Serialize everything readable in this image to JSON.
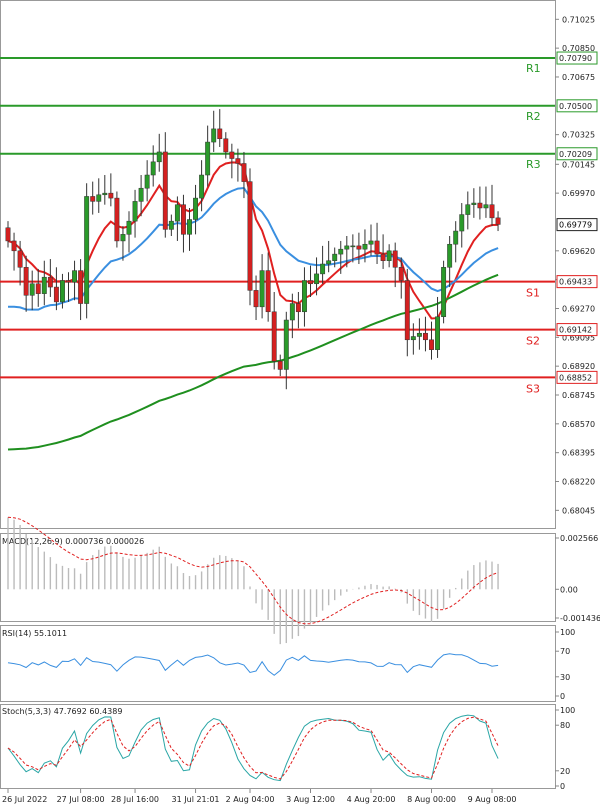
{
  "chart_data": {
    "type": "candlestick",
    "price_axis": {
      "ticks": [
        "0.71025",
        "0.70850",
        "0.70675",
        "0.70325",
        "0.70145",
        "0.69970",
        "0.69620",
        "0.69445",
        "0.69270",
        "0.69095",
        "0.68920",
        "0.68745",
        "0.68570",
        "0.68395",
        "0.68220",
        "0.68045"
      ],
      "range": [
        0.6795,
        0.7113
      ]
    },
    "time_labels": [
      {
        "label": "26 Jul 2022",
        "bar": 0
      },
      {
        "label": "27 Jul 08:00",
        "bar": 12
      },
      {
        "label": "28 Jul 16:00",
        "bar": 21
      },
      {
        "label": "31 Jul 21:01",
        "bar": 31
      },
      {
        "label": "2 Aug 04:00",
        "bar": 40
      },
      {
        "label": "3 Aug 12:00",
        "bar": 50
      },
      {
        "label": "4 Aug 20:00",
        "bar": 60
      },
      {
        "label": "8 Aug 00:00",
        "bar": 70
      },
      {
        "label": "9 Aug 08:00",
        "bar": 80
      }
    ],
    "levels": [
      {
        "name": "R1",
        "value": 0.7079,
        "tag": "0.70790",
        "color": "#2a9a2a"
      },
      {
        "name": "R2",
        "value": 0.705,
        "tag": "0.70500",
        "color": "#2a9a2a"
      },
      {
        "name": "R3",
        "value": 0.70209,
        "tag": "0.70209",
        "color": "#2a9a2a"
      },
      {
        "name": "S1",
        "value": 0.69433,
        "tag": "0.69433",
        "color": "#e02020"
      },
      {
        "name": "S2",
        "value": 0.69142,
        "tag": "0.69142",
        "color": "#e02020"
      },
      {
        "name": "S3",
        "value": 0.68852,
        "tag": "0.68852",
        "color": "#e02020"
      }
    ],
    "last_price": {
      "value": 0.69779,
      "tag": "0.69779"
    },
    "candle_closes": [
      0.6968,
      0.6962,
      0.6952,
      0.6935,
      0.6942,
      0.6936,
      0.6946,
      0.694,
      0.6931,
      0.6944,
      0.6943,
      0.695,
      0.693,
      0.6995,
      0.6992,
      0.6996,
      0.6997,
      0.6994,
      0.6968,
      0.6972,
      0.698,
      0.6992,
      0.7,
      0.7008,
      0.7016,
      0.7022,
      0.6975,
      0.698,
      0.699,
      0.6972,
      0.6981,
      0.6994,
      0.7008,
      0.7028,
      0.7036,
      0.703,
      0.7022,
      0.7018,
      0.7015,
      0.7004,
      0.6938,
      0.6928,
      0.695,
      0.6925,
      0.6895,
      0.689,
      0.692,
      0.693,
      0.6925,
      0.6944,
      0.6942,
      0.6948,
      0.6954,
      0.6956,
      0.696,
      0.6963,
      0.6965,
      0.6965,
      0.6963,
      0.6966,
      0.6968,
      0.696,
      0.6956,
      0.6962,
      0.6952,
      0.6944,
      0.6908,
      0.691,
      0.6912,
      0.6908,
      0.6902,
      0.6922,
      0.6952,
      0.6966,
      0.6974,
      0.6984,
      0.699,
      0.6991,
      0.6988,
      0.699,
      0.6982,
      0.6978
    ],
    "overlays": [
      {
        "color": "#e02020",
        "kind": "ma-fast"
      },
      {
        "color": "#3a8fe0",
        "kind": "ma-mid"
      },
      {
        "color": "#1f8f1f",
        "kind": "ma-slow"
      }
    ],
    "macd": {
      "label": "MACD(12,26,9) 0.000736 0.000026",
      "ticks": [
        "0.002566",
        "0.00",
        "-0.001436"
      ],
      "range": [
        -0.001436,
        0.002566
      ]
    },
    "rsi": {
      "label": "RSI(14) 55.1011",
      "ticks": [
        "100",
        "70",
        "30",
        "0"
      ],
      "range": [
        0,
        100
      ]
    },
    "stoch": {
      "label": "Stoch(5,3,3) 47.7692 60.4389",
      "ticks": [
        "100",
        "80",
        "20",
        "0"
      ],
      "range": [
        0,
        100
      ]
    }
  }
}
